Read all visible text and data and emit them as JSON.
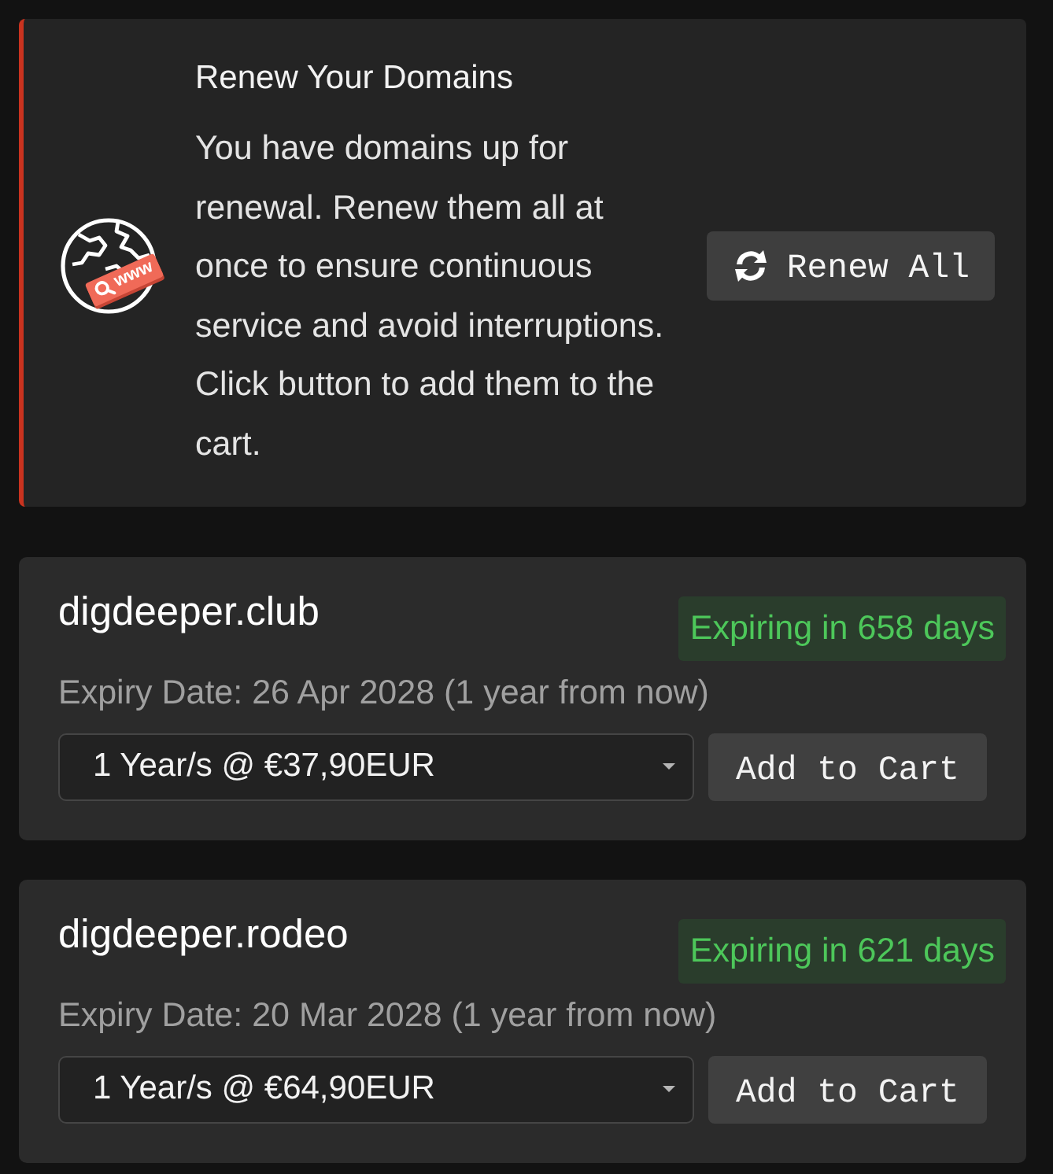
{
  "promo": {
    "title": "Renew Your Domains",
    "text": "You have domains up for renewal. Renew them all at once to ensure continuous service and avoid interruptions. Click button to add them to the cart.",
    "icon_tag": "www",
    "button": "Renew All"
  },
  "domains": [
    {
      "name": "digdeeper.club",
      "status": "Expiring in 658 days",
      "expiry": "Expiry Date: 26 Apr 2028 (1 year from now)",
      "term": "1 Year/s @ €37,90EUR",
      "button": "Add to Cart"
    },
    {
      "name": "digdeeper.rodeo",
      "status": "Expiring in 621 days",
      "expiry": "Expiry Date: 20 Mar 2028 (1 year from now)",
      "term": "1 Year/s @ €64,90EUR",
      "button": "Add to Cart"
    }
  ]
}
